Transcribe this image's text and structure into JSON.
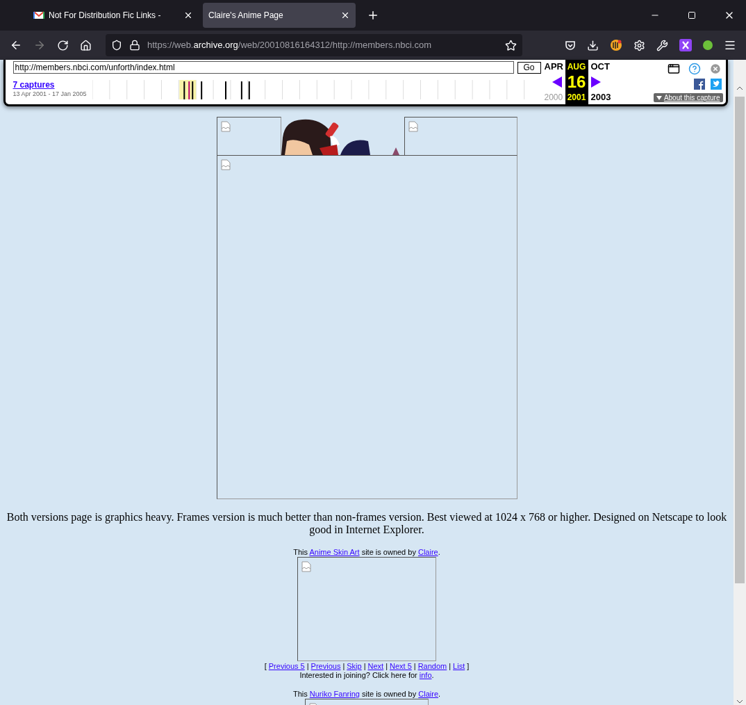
{
  "tabs": [
    {
      "title": "Not For Distribution Fic Links -",
      "selected": false
    },
    {
      "title": "Claire's Anime Page",
      "selected": true
    }
  ],
  "address_bar": {
    "prefix": "https://web.",
    "domain": "archive.org",
    "rest": "/web/20010816164312/http://members.nbci.com"
  },
  "nav_buttons": {
    "back_disabled": false,
    "forward_disabled": true
  },
  "wayback": {
    "url_value": "http://members.nbci.com/unforth/index.html",
    "go": "Go",
    "captures": "7 captures",
    "range": "13 Apr 2001 - 17 Jan 2005",
    "months": [
      {
        "kind": "previous",
        "month": "APR",
        "year": "2000",
        "selected": false,
        "disabled": true
      },
      {
        "kind": "current",
        "month": "AUG",
        "year": "2001",
        "day": "16",
        "selected": true,
        "disabled": false
      },
      {
        "kind": "next",
        "month": "OCT",
        "year": "2003",
        "selected": false,
        "disabled": false
      }
    ],
    "about": "About this capture"
  },
  "description": "Both versions page is graphics heavy. Frames version is much better than non-frames version. Best viewed at 1024 x 768 or higher. Designed on Netscape to look good in Internet Explorer.",
  "webrings": [
    {
      "before": "This ",
      "ring": "Anime Skin Art",
      "middle": " site is owned by ",
      "owner": "Claire",
      "after": ".",
      "nav": [
        {
          "kind": "separator",
          "text": "["
        },
        {
          "kind": "link",
          "text": "Previous 5"
        },
        {
          "kind": "separator",
          "text": "|"
        },
        {
          "kind": "link",
          "text": "Previous"
        },
        {
          "kind": "separator",
          "text": "|"
        },
        {
          "kind": "link",
          "text": "Skip"
        },
        {
          "kind": "separator",
          "text": "|"
        },
        {
          "kind": "link",
          "text": "Next"
        },
        {
          "kind": "separator",
          "text": "|"
        },
        {
          "kind": "link",
          "text": "Next 5"
        },
        {
          "kind": "separator",
          "text": "|"
        },
        {
          "kind": "link",
          "text": "Random"
        },
        {
          "kind": "separator",
          "text": "|"
        },
        {
          "kind": "link",
          "text": "List"
        },
        {
          "kind": "separator",
          "text": "]"
        }
      ],
      "join_before": "Interested in joining? Click here for ",
      "join_link": "info",
      "join_after": "."
    },
    {
      "before": "This ",
      "ring": "Nuriko Fanring",
      "middle": " site is owned by ",
      "owner": "Claire",
      "after": "."
    }
  ]
}
